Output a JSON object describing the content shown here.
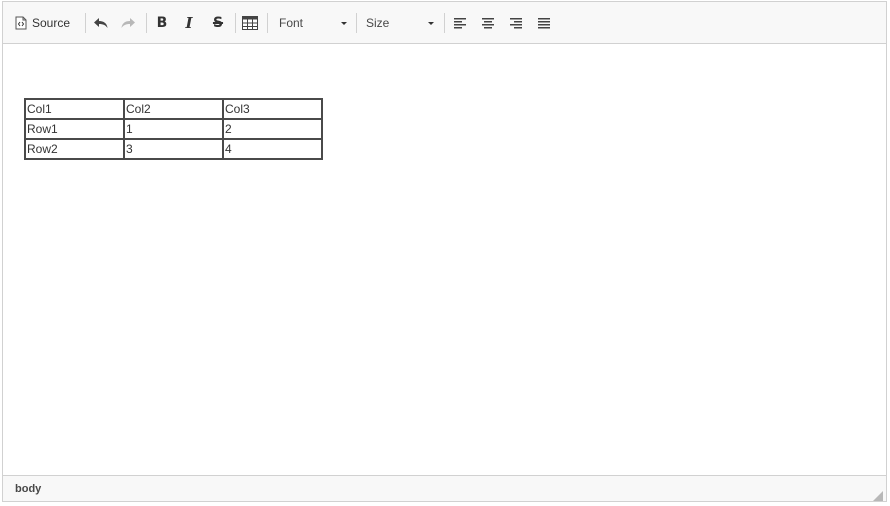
{
  "toolbar": {
    "source_label": "Source",
    "font_label": "Font",
    "size_label": "Size",
    "icons": {
      "source": "source-icon",
      "undo": "undo-icon",
      "redo": "redo-icon",
      "bold": "B",
      "italic": "I",
      "strike": "S",
      "table": "table-icon",
      "align_left": "align-left-icon",
      "align_center": "align-center-icon",
      "align_right": "align-right-icon",
      "justify": "align-justify-icon"
    }
  },
  "table": {
    "rows": [
      [
        "Col1",
        "Col2",
        "Col3"
      ],
      [
        "Row1",
        "1",
        "2"
      ],
      [
        "Row2",
        "3",
        "4"
      ]
    ]
  },
  "statusbar": {
    "path": "body"
  },
  "colors": {
    "toolbar_bg": "#f8f8f8",
    "border": "#d1d1d1",
    "icon": "#484848",
    "table_border": "#4a4a4a",
    "redo_disabled": "#b8b8b8"
  }
}
